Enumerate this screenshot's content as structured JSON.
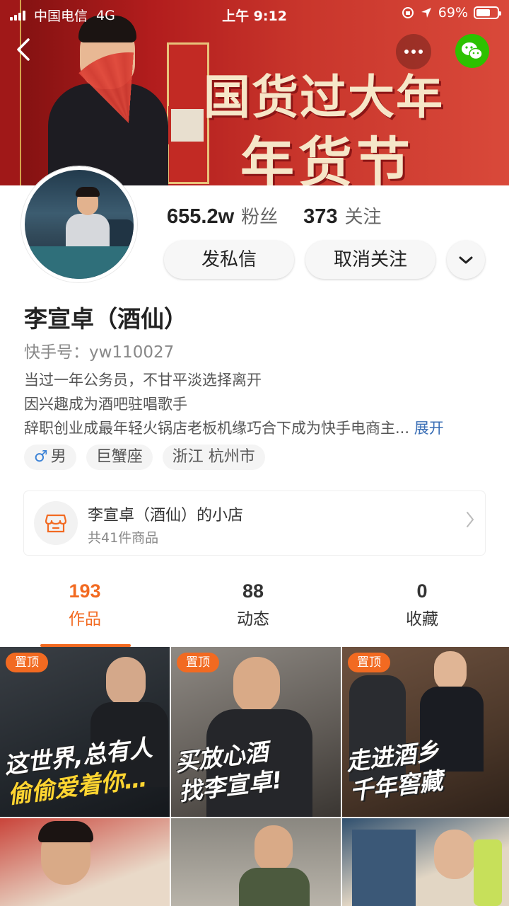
{
  "status_bar": {
    "carrier": "中国电信",
    "network": "4G",
    "time": "上午 9:12",
    "battery": "69%",
    "battery_level": 0.69
  },
  "banner": {
    "title_line1": "国货过大年",
    "title_line2": "年货节"
  },
  "profile": {
    "followers_count": "655.2w",
    "followers_label": "粉丝",
    "following_count": "373",
    "following_label": "关注",
    "message_button": "发私信",
    "unfollow_button": "取消关注",
    "name": "李宣卓（酒仙）",
    "kuaishou_id": "快手号：yw110027",
    "bio_lines": [
      "当过一年公务员，不甘平淡选择离开",
      "因兴趣成为酒吧驻唱歌手",
      "辞职创业成最年轻火锅店老板机缘巧合下成为快手电商主..."
    ],
    "bio_expand": "展开",
    "tags": {
      "gender_symbol": "♂",
      "gender": "男",
      "zodiac": "巨蟹座",
      "location": "浙江 杭州市"
    }
  },
  "shop": {
    "title": "李宣卓（酒仙）的小店",
    "subtitle": "共41件商品"
  },
  "tabs": [
    {
      "count": "193",
      "label": "作品",
      "active": true
    },
    {
      "count": "88",
      "label": "动态",
      "active": false
    },
    {
      "count": "0",
      "label": "收藏",
      "active": false
    }
  ],
  "videos": [
    {
      "pin_label": "置顶",
      "caption_line1": "这世界,总有人",
      "caption_line2": "偷偷爱着你…"
    },
    {
      "pin_label": "置顶",
      "caption_line1": "买放心酒",
      "caption_line2": "找李宣卓!"
    },
    {
      "pin_label": "置顶",
      "caption_line1": "走进酒乡",
      "caption_line2": "千年窖藏"
    }
  ],
  "colors": {
    "accent": "#f26a21",
    "link": "#3b6fb6",
    "wechat": "#2dc100",
    "male": "#3b82d6"
  }
}
